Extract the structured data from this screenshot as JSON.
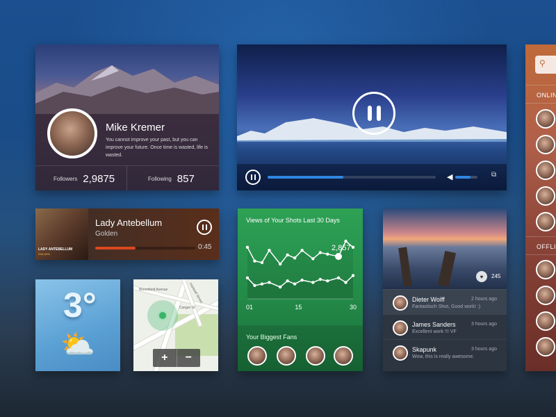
{
  "profile": {
    "name": "Mike Kremer",
    "bio": "You cannot improve your past, but you can improve your future. Once time is wasted, life is wasted.",
    "followers_label": "Followers",
    "followers_value": "2,9875",
    "following_label": "Following",
    "following_value": "857"
  },
  "video": {
    "progress": 0.45,
    "volume": 0.7,
    "icons": [
      "pause-icon",
      "volume-icon",
      "fullscreen-icon"
    ]
  },
  "music": {
    "title": "Lady Antebellum",
    "subtitle": "Golden",
    "time": "0:45",
    "progress": 0.4,
    "album_text": "LADY ANTEBELLUM",
    "album_subtext": "GOLDEN",
    "accent": "#d9481e"
  },
  "weather": {
    "temperature": "3°",
    "icon": "partly-cloudy-icon"
  },
  "map": {
    "streets": [
      "Bloomfield Avenue",
      "Hartwell Street",
      "Conger St"
    ],
    "zoom_in": "+",
    "zoom_out": "−"
  },
  "stats": {
    "title": "Views of Your Shots Last 30 Days",
    "highlight_value": "2,857",
    "x_labels": [
      "01",
      "15",
      "30"
    ],
    "fans_title": "Your Biggest Fans"
  },
  "chart_data": {
    "type": "line",
    "title": "Views of Your Shots Last 30 Days",
    "x": [
      1,
      3,
      5,
      7,
      10,
      12,
      14,
      16,
      19,
      21,
      23,
      26,
      28,
      30
    ],
    "xticks": [
      "01",
      "15",
      "30"
    ],
    "series": [
      {
        "values": [
          62,
          44,
          42,
          58,
          40,
          52,
          48,
          58,
          47,
          55,
          53,
          50,
          70,
          62
        ]
      },
      {
        "values": [
          22,
          12,
          14,
          16,
          10,
          18,
          14,
          19,
          16,
          20,
          18,
          22,
          16,
          25
        ]
      }
    ],
    "annotation": {
      "x": 26,
      "value": "2,857"
    },
    "ylim": [
      0,
      80
    ],
    "grid": false,
    "accent": "#ffffff"
  },
  "photo": {
    "likes": "245",
    "comments": [
      {
        "name": "Dieter Wolff",
        "text": "Fantastisch Shot, Good work! :)",
        "time": "2 hours ago"
      },
      {
        "name": "James Sanders",
        "text": "Excellent work !!! VF",
        "time": "3 hours ago"
      },
      {
        "name": "Skapunk",
        "text": "Wow, this is really awesome.",
        "time": "3 hours ago"
      }
    ]
  },
  "sidebar": {
    "online_label": "ONLINE",
    "offline_label": "OFFLINE",
    "brand": "#c06a3a"
  }
}
